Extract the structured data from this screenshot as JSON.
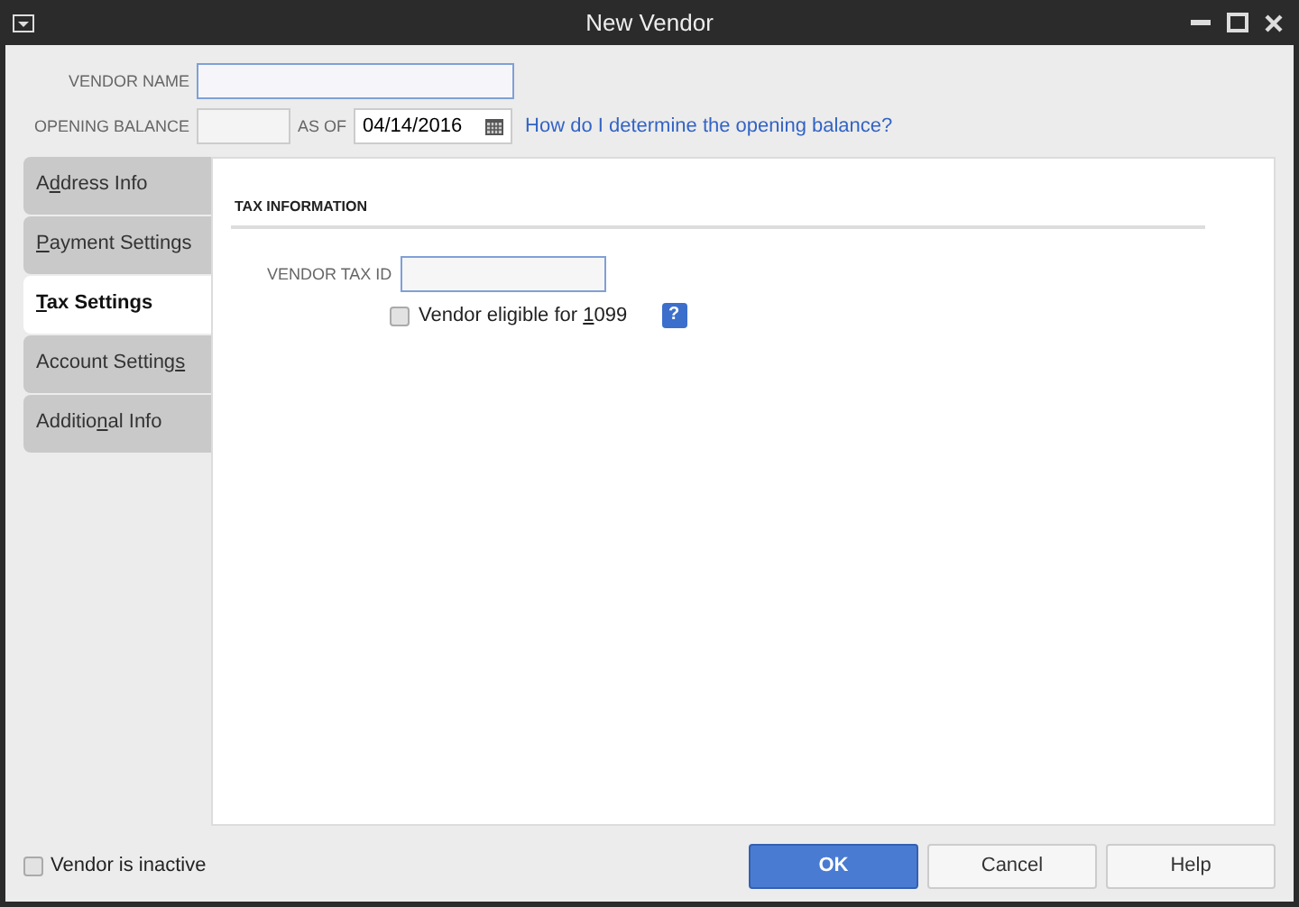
{
  "window": {
    "title": "New Vendor"
  },
  "header": {
    "vendor_name_label": "VENDOR NAME",
    "opening_balance_label": "OPENING BALANCE",
    "as_of_label": "AS OF",
    "as_of_value": "04/14/2016",
    "help_link": "How do I determine the opening balance?"
  },
  "tabs": [
    {
      "label": {
        "before": "A",
        "key": "d",
        "after": "dress Info"
      },
      "selected": false
    },
    {
      "label": {
        "key": "P",
        "after": "ayment Settings"
      },
      "selected": false
    },
    {
      "label": {
        "key": "T",
        "after": "ax Settings"
      },
      "selected": true
    },
    {
      "label": {
        "before": "Account Setting",
        "key": "s"
      },
      "selected": false
    },
    {
      "label": {
        "before": "Additio",
        "key": "n",
        "after": "al Info"
      },
      "selected": false
    }
  ],
  "panel": {
    "section_title": "TAX INFORMATION",
    "tax_id_label": "VENDOR TAX ID",
    "eligible_1099": {
      "label": [
        "Vendor eligible for ",
        "1",
        "099"
      ],
      "checked": false
    },
    "help_icon_text": "?"
  },
  "footer": {
    "inactive": {
      "label": "Vendor is inactive",
      "checked": false
    },
    "buttons": [
      {
        "label": "OK",
        "kind": "primary"
      },
      {
        "label": "Cancel",
        "kind": "normal"
      },
      {
        "label": "Help",
        "kind": "normal"
      }
    ]
  }
}
